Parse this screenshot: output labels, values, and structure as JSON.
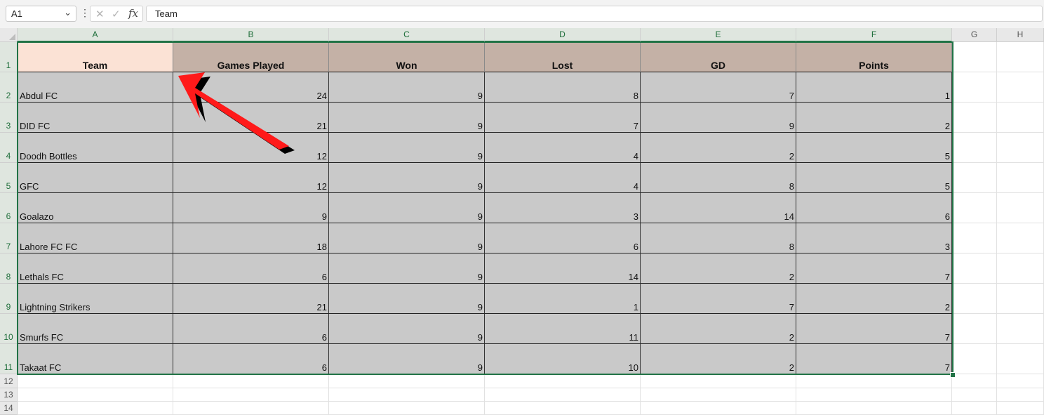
{
  "formula_bar": {
    "name_box": "A1",
    "formula": "Team",
    "cancel_icon": "x-icon",
    "enter_icon": "check-icon",
    "function_icon": "fx-icon"
  },
  "columns": [
    "A",
    "B",
    "C",
    "D",
    "E",
    "F",
    "G",
    "H"
  ],
  "rows": [
    "1",
    "2",
    "3",
    "4",
    "5",
    "6",
    "7",
    "8",
    "9",
    "10",
    "11",
    "12",
    "13",
    "14"
  ],
  "table": {
    "headers": [
      "Team",
      "Games Played",
      "Won",
      "Lost",
      "GD",
      "Points"
    ],
    "rows": [
      [
        "Abdul FC",
        "24",
        "9",
        "8",
        "7",
        "1"
      ],
      [
        "DID FC",
        "21",
        "9",
        "7",
        "9",
        "2"
      ],
      [
        "Doodh Bottles",
        "12",
        "9",
        "4",
        "2",
        "5"
      ],
      [
        "GFC",
        "12",
        "9",
        "4",
        "8",
        "5"
      ],
      [
        "Goalazo",
        "9",
        "9",
        "3",
        "14",
        "6"
      ],
      [
        "Lahore FC FC",
        "18",
        "9",
        "6",
        "8",
        "3"
      ],
      [
        "Lethals FC",
        "6",
        "9",
        "14",
        "2",
        "7"
      ],
      [
        "Lightning Strikers",
        "21",
        "9",
        "1",
        "7",
        "2"
      ],
      [
        "Smurfs FC",
        "6",
        "9",
        "11",
        "2",
        "7"
      ],
      [
        "Takaat FC",
        "6",
        "9",
        "10",
        "2",
        "7"
      ]
    ]
  },
  "colors": {
    "header_fill": "#c4b1a6",
    "first_header_fill": "#fbe2d5",
    "data_fill": "#c9c9c9",
    "selection": "#217346",
    "annotation_arrow": "#ff0000"
  }
}
